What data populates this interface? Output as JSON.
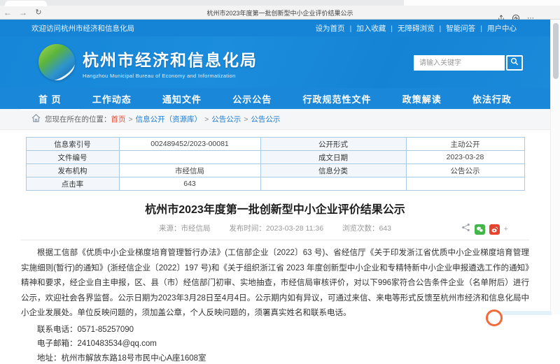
{
  "colors": {
    "primary_blue": "#1584d6",
    "nav_blue": "#1b87d8",
    "crumb_red": "#e8442c",
    "link_blue": "#1e7cd0",
    "table_border": "#a9cae4",
    "wechat_green": "#44b549",
    "weibo_red": "#e6442e"
  },
  "icons": {
    "back": "←",
    "forward": "→",
    "refresh": "↻",
    "more": "⋯",
    "plus": "+"
  },
  "browser": {
    "title": "杭州市2023年度第一批创新型中小企业评价结果公示"
  },
  "topbar": {
    "welcome": "欢迎访问杭州市经济和信息化局",
    "links": [
      "设为首页",
      "加入收藏",
      "无障碍浏览",
      "智能问答",
      "用户中心"
    ]
  },
  "header": {
    "site_name": "杭州市经济和信息化局",
    "site_name_en": "Hangzhou Municipal Bureau of Economy and Informatization",
    "search_placeholder": "请输入关键字"
  },
  "nav": {
    "items": [
      {
        "label": "首 页",
        "active": true
      },
      {
        "label": "工作动态",
        "active": false
      },
      {
        "label": "通知文件",
        "active": false
      },
      {
        "label": "公示公告",
        "active": false
      },
      {
        "label": "行政规范性文件",
        "active": false
      },
      {
        "label": "政策解读",
        "active": false
      },
      {
        "label": "依法行政",
        "active": false
      }
    ]
  },
  "breadcrumb": {
    "prefix": "您现在所在的位置：",
    "items": [
      "首页",
      "信息公开（资源库）",
      "公告公示",
      "公告公示"
    ]
  },
  "info_table": {
    "rows": [
      {
        "c0": "信息索引号",
        "c1": "002489452/2023-00081",
        "c2": "公开形式",
        "c3": "主动公开"
      },
      {
        "c0": "文件编号",
        "c1": "",
        "c2": "成文日期",
        "c3": "2023-03-28"
      },
      {
        "c0": "发布机构",
        "c1": "市经信局",
        "c2": "信息分类",
        "c3": "公告公示"
      },
      {
        "c0": "点击率",
        "c1": "643",
        "c2": "",
        "c3": ""
      }
    ]
  },
  "article": {
    "title": "杭州市2023年度第一批创新型中小企业评价结果公示",
    "source": "来源：市经信局",
    "publish_time": "发布时间：2023-03-28 11:36",
    "views": "浏览次数：643",
    "paragraph": "根据工信部《优质中小企业梯度培育管理暂行办法》(工信部企业〔2022〕63 号)、省经信厅《关于印发浙江省优质中小企业梯度培育管理实施细则(暂行)的通知》(浙经信企业〔2022〕197 号)和《关于组织浙江省 2023 年度创新型中小企业和专精特新中小企业申报遴选工作的通知》精神和要求，经企业自主申报，区、县（市）经信部门初审、实地抽查，市经信局审核评价，对以下996家符合公告条件企业（名单附后）进行公示，欢迎社会各界监督。公示日期为2023年3月28日至4月4日。公示期内如有异议，可通过来信、来电等形式反馈至杭州市经济和信息化局中小企业发展处。单位反映问题的，须加盖公章，个人反映问题的，须署真实姓名和联系电话。",
    "contact_phone": "联系电话：0571-85257090",
    "contact_email": "电子邮箱：2410483534@qq.com",
    "contact_address": "地址：杭州市解放东路18号市民中心A座1608室"
  }
}
